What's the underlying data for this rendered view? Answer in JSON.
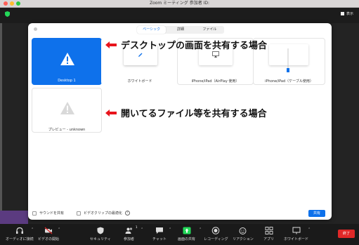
{
  "window": {
    "title": "Zoom ミーティング 参加者 ID:"
  },
  "topbar": {
    "view_label": "表示"
  },
  "dialog": {
    "tabs": [
      {
        "label": "ベーシック",
        "active": true
      },
      {
        "label": "詳細",
        "active": false
      },
      {
        "label": "ファイル",
        "active": false
      }
    ],
    "tiles": {
      "desktop": "Desktop 1",
      "whiteboard": "ホワイトボード",
      "airplay": "iPhone/iPad（AirPlay 使用）",
      "cable": "iPhone/iPad（ケーブル使用）",
      "preview": "プレビュー - unknown"
    },
    "options": {
      "share_sound": "サウンドを共有",
      "optimize_video": "ビデオクリップの最適化",
      "help": "?"
    },
    "share_button": "共有"
  },
  "callouts": {
    "desktop": "デスクトップの画面を共有する場合",
    "file": "開いてるファイル等を共有する場合"
  },
  "toolbar": {
    "items": [
      {
        "label": "オーディオに接続"
      },
      {
        "label": "ビデオの開始"
      },
      {
        "label": "セキュリティ"
      },
      {
        "label": "参加者",
        "count": "1"
      },
      {
        "label": "チャット"
      },
      {
        "label": "画面の共有"
      },
      {
        "label": "レコーディング"
      },
      {
        "label": "リアクション"
      },
      {
        "label": "アプリ"
      },
      {
        "label": "ホワイトボード"
      }
    ],
    "end_label": "終了"
  },
  "colors": {
    "accent": "#0e71eb",
    "share_green": "#23d959",
    "end_red": "#e02828",
    "arrow_red": "#e8141c"
  }
}
